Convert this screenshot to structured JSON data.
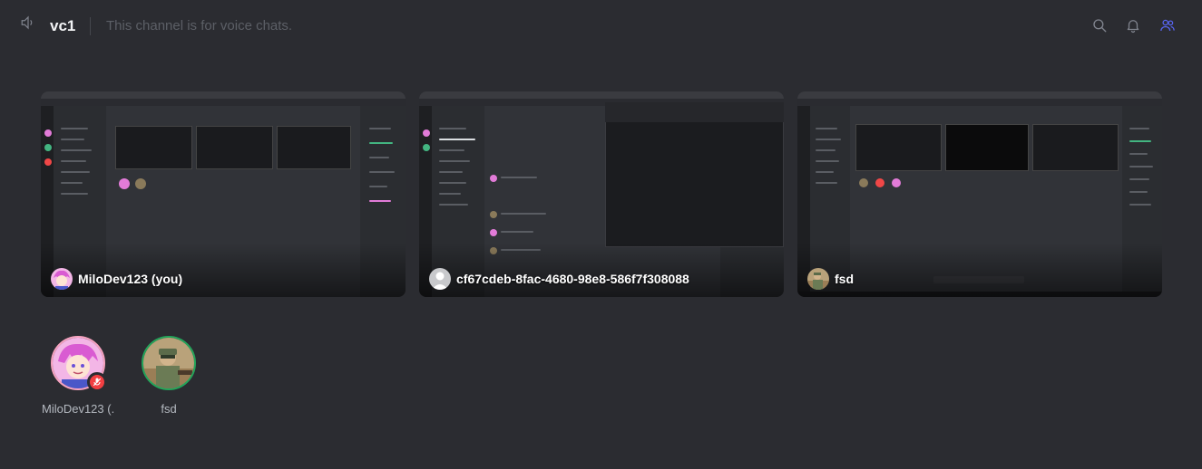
{
  "header": {
    "channel_name": "vc1",
    "topic": "This channel is for voice chats.",
    "icons": [
      "speaker-icon",
      "search-icon",
      "bell-icon",
      "members-icon"
    ]
  },
  "streams": [
    {
      "name": "MiloDev123 (you)"
    },
    {
      "name": "cf67cdeb-8fac-4680-98e8-586f7f308088"
    },
    {
      "name": "fsd"
    }
  ],
  "participants": [
    {
      "name": "MiloDev123 (...",
      "muted": true
    },
    {
      "name": "fsd",
      "muted": false
    }
  ],
  "colors": {
    "background": "#2b2c31",
    "accent_members_icon": "#5865f2",
    "muted_red": "#f23f42",
    "speaking_green": "#23a55a"
  }
}
